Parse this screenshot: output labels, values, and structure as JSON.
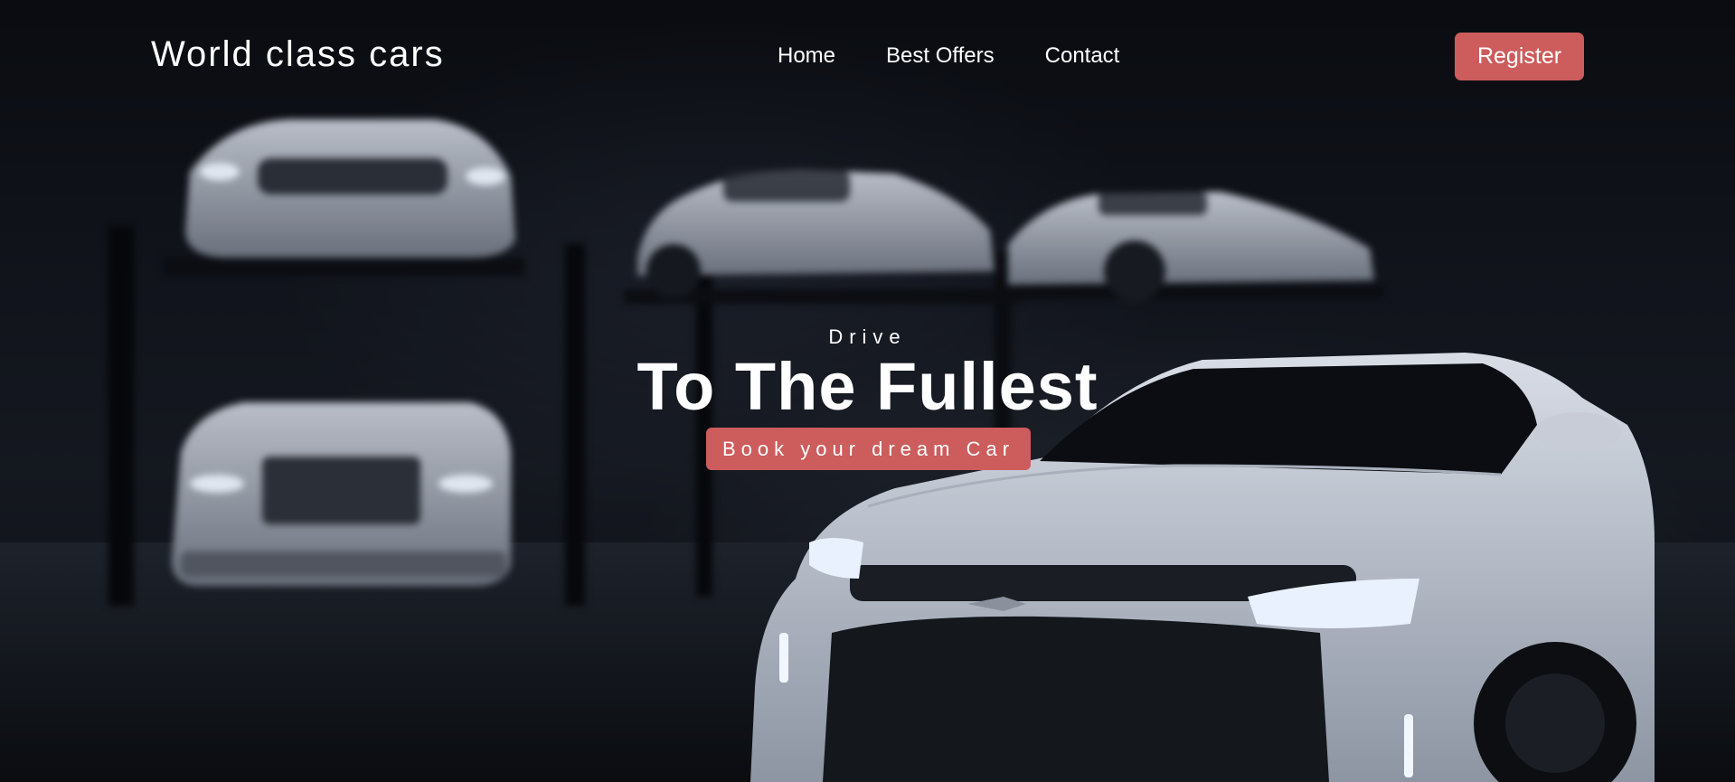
{
  "brand": {
    "logo_text": "World class cars"
  },
  "nav": {
    "links": [
      {
        "label": "Home"
      },
      {
        "label": "Best Offers"
      },
      {
        "label": "Contact"
      }
    ],
    "register_label": "Register"
  },
  "hero": {
    "eyebrow": "Drive",
    "headline": "To The Fullest",
    "cta_label": "Book your dream Car",
    "background": "dark garage with white sports car"
  },
  "colors": {
    "accent": "#cd5c5c",
    "text": "#ffffff",
    "background": "#05070b"
  }
}
